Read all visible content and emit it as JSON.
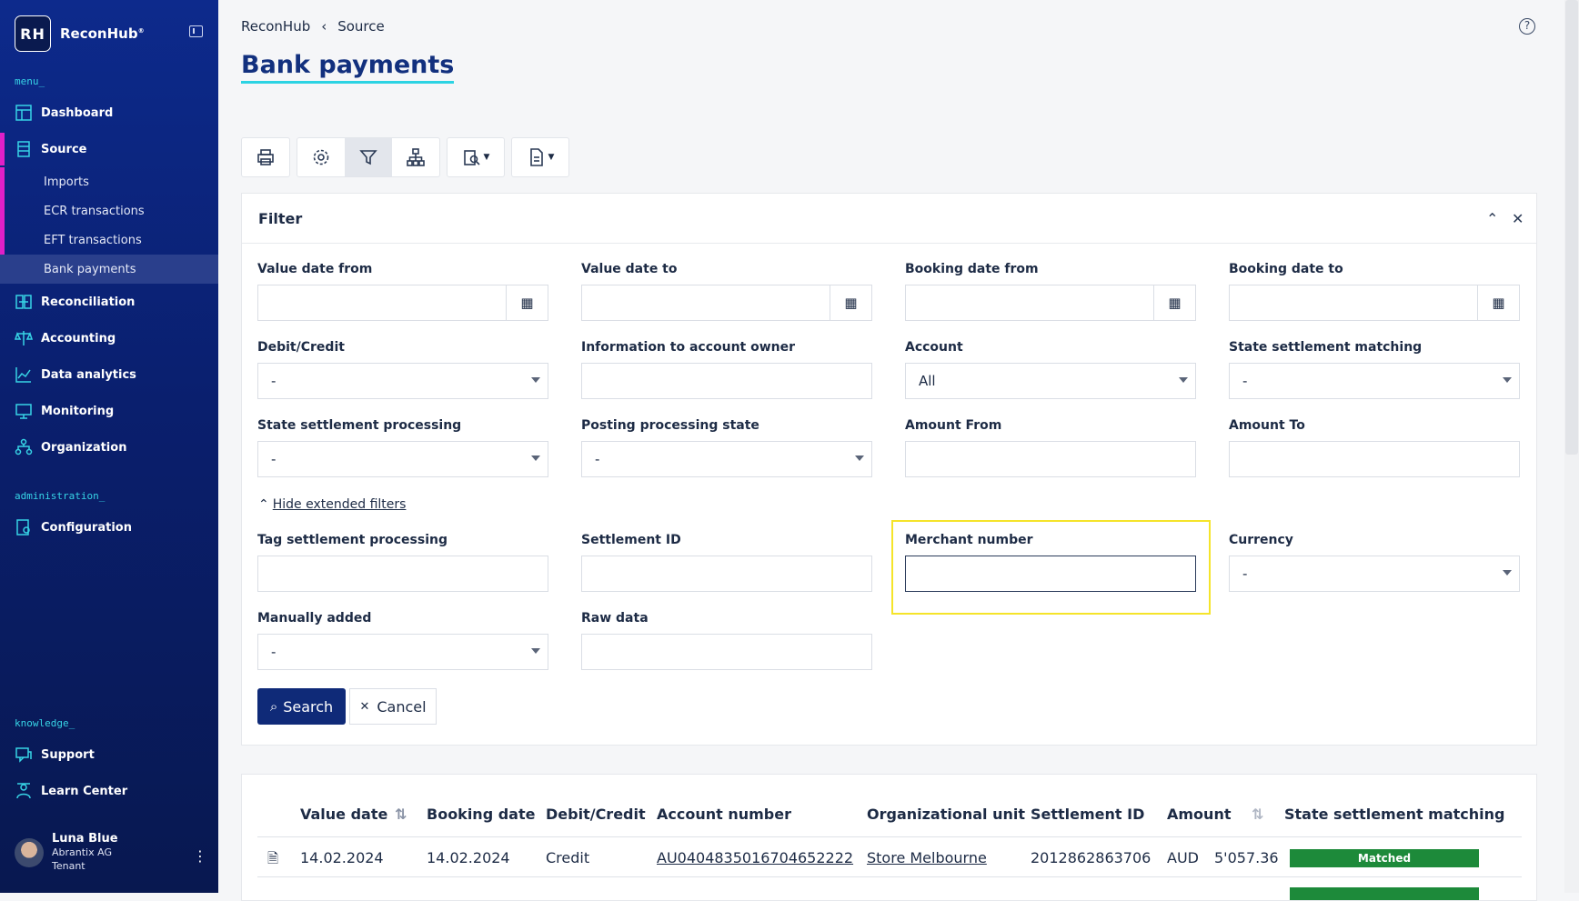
{
  "app": {
    "name": "ReconHub",
    "logo_letters": "RH",
    "logo_mark": "®"
  },
  "sidebar": {
    "sections": {
      "menu": "menu_",
      "administration": "administration_",
      "knowledge": "knowledge_"
    },
    "items": [
      {
        "label": "Dashboard",
        "icon": "dashboard-icon"
      },
      {
        "label": "Source",
        "icon": "source-icon"
      },
      {
        "label": "Reconciliation",
        "icon": "reconciliation-icon"
      },
      {
        "label": "Accounting",
        "icon": "scale-icon"
      },
      {
        "label": "Data analytics",
        "icon": "chart-icon"
      },
      {
        "label": "Monitoring",
        "icon": "monitor-icon"
      },
      {
        "label": "Organization",
        "icon": "org-icon"
      },
      {
        "label": "Configuration",
        "icon": "config-icon"
      },
      {
        "label": "Support",
        "icon": "chat-icon"
      },
      {
        "label": "Learn Center",
        "icon": "learn-icon"
      }
    ],
    "source_children": [
      "Imports",
      "ECR transactions",
      "EFT transactions",
      "Bank payments"
    ],
    "user": {
      "name": "Luna Blue",
      "company": "Abrantix AG",
      "role": "Tenant"
    }
  },
  "breadcrumb": {
    "root": "ReconHub",
    "current": "Source"
  },
  "page_title": "Bank payments",
  "filter": {
    "title": "Filter",
    "fields": {
      "value_date_from": {
        "label": "Value date from",
        "value": ""
      },
      "value_date_to": {
        "label": "Value date to",
        "value": ""
      },
      "booking_date_from": {
        "label": "Booking date from",
        "value": ""
      },
      "booking_date_to": {
        "label": "Booking date to",
        "value": ""
      },
      "debit_credit": {
        "label": "Debit/Credit",
        "value": "-"
      },
      "info_owner": {
        "label": "Information to account owner",
        "value": ""
      },
      "account": {
        "label": "Account",
        "value": "All"
      },
      "state_settlement_matching": {
        "label": "State settlement matching",
        "value": "-"
      },
      "state_settlement_processing": {
        "label": "State settlement processing",
        "value": "-"
      },
      "posting_processing_state": {
        "label": "Posting processing state",
        "value": "-"
      },
      "amount_from": {
        "label": "Amount From",
        "value": ""
      },
      "amount_to": {
        "label": "Amount To",
        "value": ""
      },
      "tag_settlement_processing": {
        "label": "Tag settlement processing",
        "value": ""
      },
      "settlement_id": {
        "label": "Settlement ID",
        "value": ""
      },
      "merchant_number": {
        "label": "Merchant number",
        "value": ""
      },
      "currency": {
        "label": "Currency",
        "value": "-"
      },
      "manually_added": {
        "label": "Manually added",
        "value": "-"
      },
      "raw_data": {
        "label": "Raw data",
        "value": ""
      }
    },
    "hide_extended": "Hide extended filters",
    "search_label": "Search",
    "cancel_label": "Cancel"
  },
  "table": {
    "columns": [
      "Value date",
      "Booking date",
      "Debit/Credit",
      "Account number",
      "Organizational unit",
      "Settlement ID",
      "Amount",
      "State settlement matching"
    ],
    "rows": [
      {
        "value_date": "14.02.2024",
        "booking_date": "14.02.2024",
        "debit_credit": "Credit",
        "account": "AU0404835016704652222",
        "org_unit": "Store Melbourne",
        "settlement_id": "2012862863706",
        "currency": "AUD",
        "amount": "5'057.36",
        "state": "Matched"
      }
    ]
  },
  "colors": {
    "accent": "#0f2a78",
    "highlight": "#f5e42a",
    "matched": "#1d8a3a",
    "active_bar": "#e020c8"
  }
}
